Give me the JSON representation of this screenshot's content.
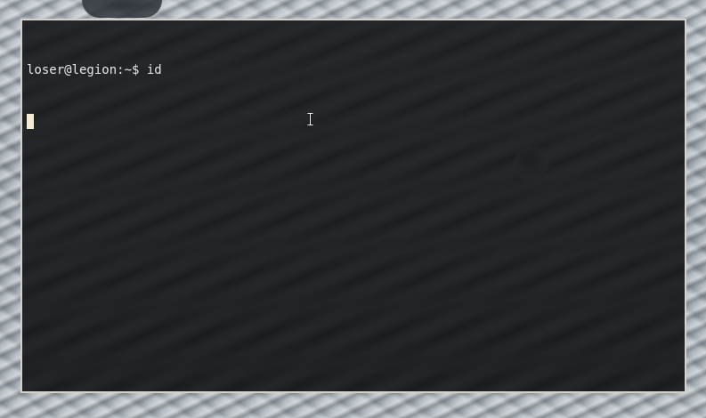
{
  "desktop": {
    "wallpaper": "grey-dunes"
  },
  "terminal": {
    "prompt": "loser@legion:~$",
    "command": " id",
    "cursor_line": ""
  },
  "colors": {
    "terminal_bg": "#232528",
    "terminal_fg": "#e8e8e8",
    "cursor": "#f2ecd2",
    "window_border": "#d5d2cc"
  },
  "icons": {
    "mouse_pointer": "ibeam-cursor-icon"
  }
}
